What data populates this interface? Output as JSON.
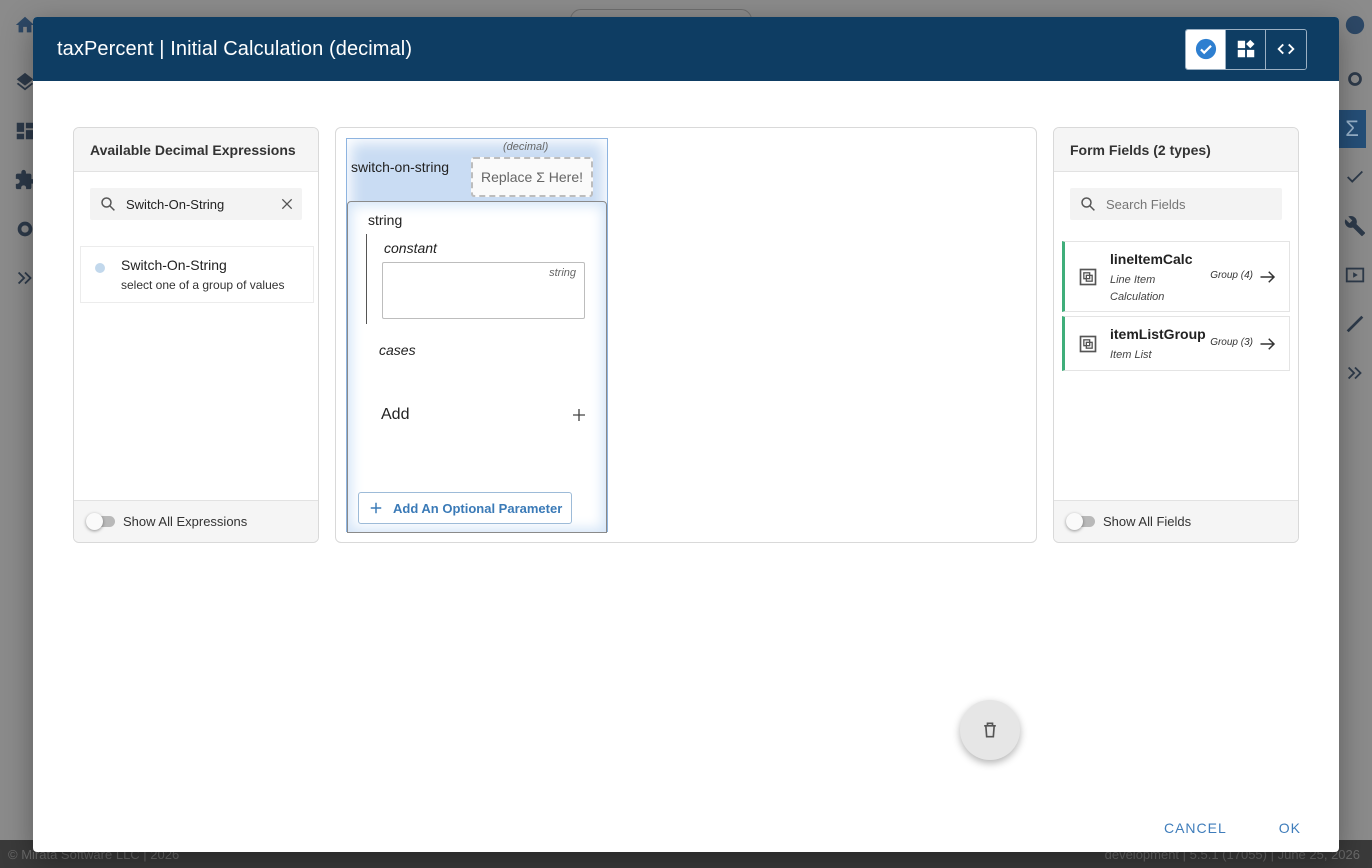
{
  "background": {
    "footer_left": "© Mirata Software LLC | 2026",
    "footer_right": "development | 5.5.1 (17055) | June 25, 2026",
    "sigma_label": "Σ"
  },
  "dialog": {
    "title": "taxPercent | Initial Calculation (decimal)",
    "mode_icons": [
      "check-circle-icon",
      "widgets-icon",
      "code-icon"
    ],
    "active_mode": 0
  },
  "left_panel": {
    "title": "Available Decimal Expressions",
    "search_value": "Switch-On-String",
    "items": [
      {
        "title": "Switch-On-String",
        "description": "select one of a group of values"
      }
    ],
    "toggle_label": "Show All Expressions"
  },
  "builder": {
    "function_name": "switch-on-string",
    "type_hint": "(decimal)",
    "replace_label": "Replace Σ Here!",
    "param_string": "string",
    "param_constant": "constant",
    "constant_type_hint": "string",
    "param_cases": "cases",
    "add_label": "Add",
    "optional_param_label": "Add An Optional Parameter"
  },
  "right_panel": {
    "title": "Form Fields (2 types)",
    "search_placeholder": "Search Fields",
    "fields": [
      {
        "name": "lineItemCalc",
        "description_1": "Line Item",
        "description_2": "Calculation",
        "group": "Group (4)"
      },
      {
        "name": "itemListGroup",
        "description_1": "Item List",
        "group": "Group (3)"
      }
    ],
    "toggle_label": "Show All Fields"
  },
  "actions": {
    "cancel": "CANCEL",
    "ok": "OK"
  },
  "colors": {
    "header": "#0e3d63",
    "accent": "#3f7dbb",
    "field_border": "#3fae7a"
  }
}
